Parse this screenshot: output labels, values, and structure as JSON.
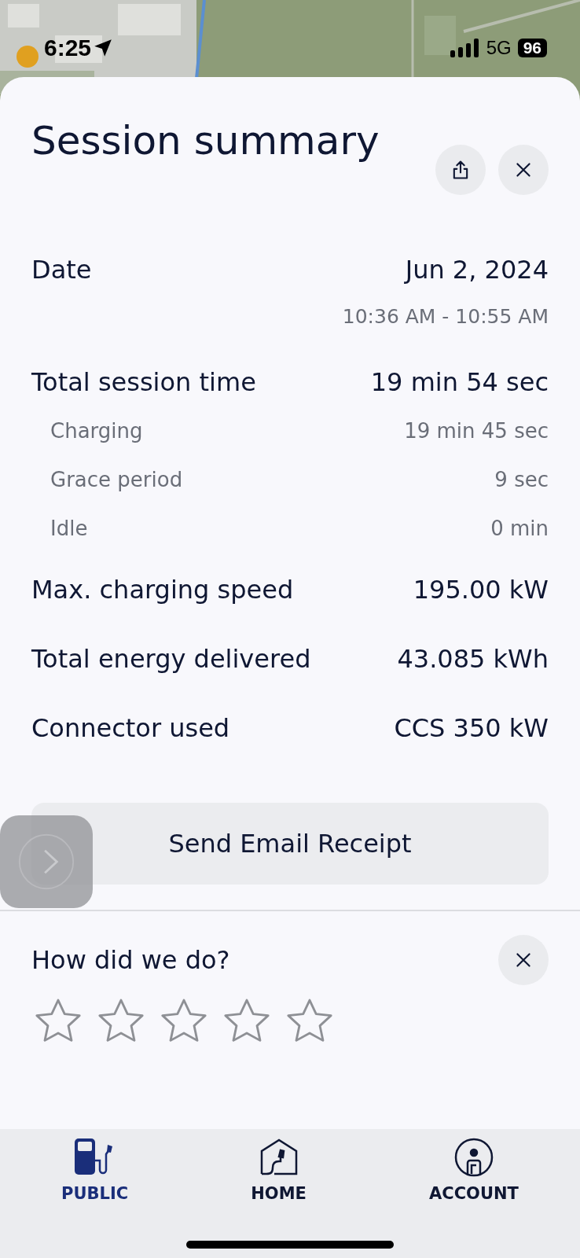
{
  "status_bar": {
    "time": "6:25",
    "network": "5G",
    "battery": "96"
  },
  "sheet": {
    "title": "Session summary"
  },
  "details": [
    {
      "kind": "main",
      "label": "Date",
      "value": "Jun 2, 2024",
      "subvalue": "10:36 AM - 10:55 AM"
    },
    {
      "kind": "main",
      "label": "Total session time",
      "value": "19 min 54 sec"
    },
    {
      "kind": "sub",
      "label": "Charging",
      "value": "19 min 45 sec"
    },
    {
      "kind": "sub",
      "label": "Grace period",
      "value": "9 sec"
    },
    {
      "kind": "sub",
      "label": "Idle",
      "value": "0 min"
    },
    {
      "kind": "main",
      "label": "Max. charging speed",
      "value": "195.00 kW"
    },
    {
      "kind": "main",
      "label": "Total energy delivered",
      "value": "43.085 kWh"
    },
    {
      "kind": "main",
      "label": "Connector used",
      "value": "CCS 350 kW"
    }
  ],
  "receipt_button": "Send Email Receipt",
  "feedback": {
    "question": "How did we do?",
    "stars": 0
  },
  "tabs": [
    {
      "label": "PUBLIC",
      "selected": true
    },
    {
      "label": "HOME",
      "selected": false
    },
    {
      "label": "ACCOUNT",
      "selected": false
    }
  ]
}
